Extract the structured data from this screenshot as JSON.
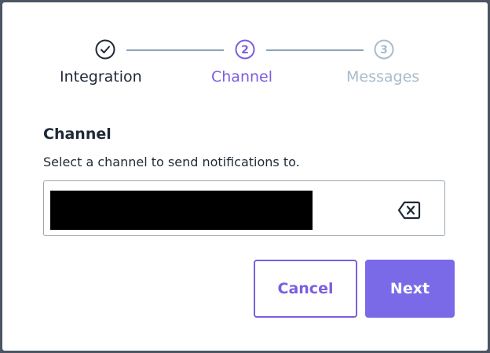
{
  "colors": {
    "accent": "#7b5ee0",
    "text_dark": "#1f2937",
    "inactive": "#a9bccc",
    "connector": "#8ea3b6",
    "backdrop": "#4b5563"
  },
  "stepper": {
    "steps": [
      {
        "label": "Integration",
        "state": "complete",
        "icon": "check-circle-icon"
      },
      {
        "label": "Channel",
        "state": "active",
        "number": "2"
      },
      {
        "label": "Messages",
        "state": "inactive",
        "number": "3"
      }
    ]
  },
  "field": {
    "title": "Channel",
    "help": "Select a channel to send notifications to.",
    "value_state": "redacted",
    "clear_icon": "backspace-clear-icon"
  },
  "actions": {
    "cancel_label": "Cancel",
    "next_label": "Next"
  }
}
